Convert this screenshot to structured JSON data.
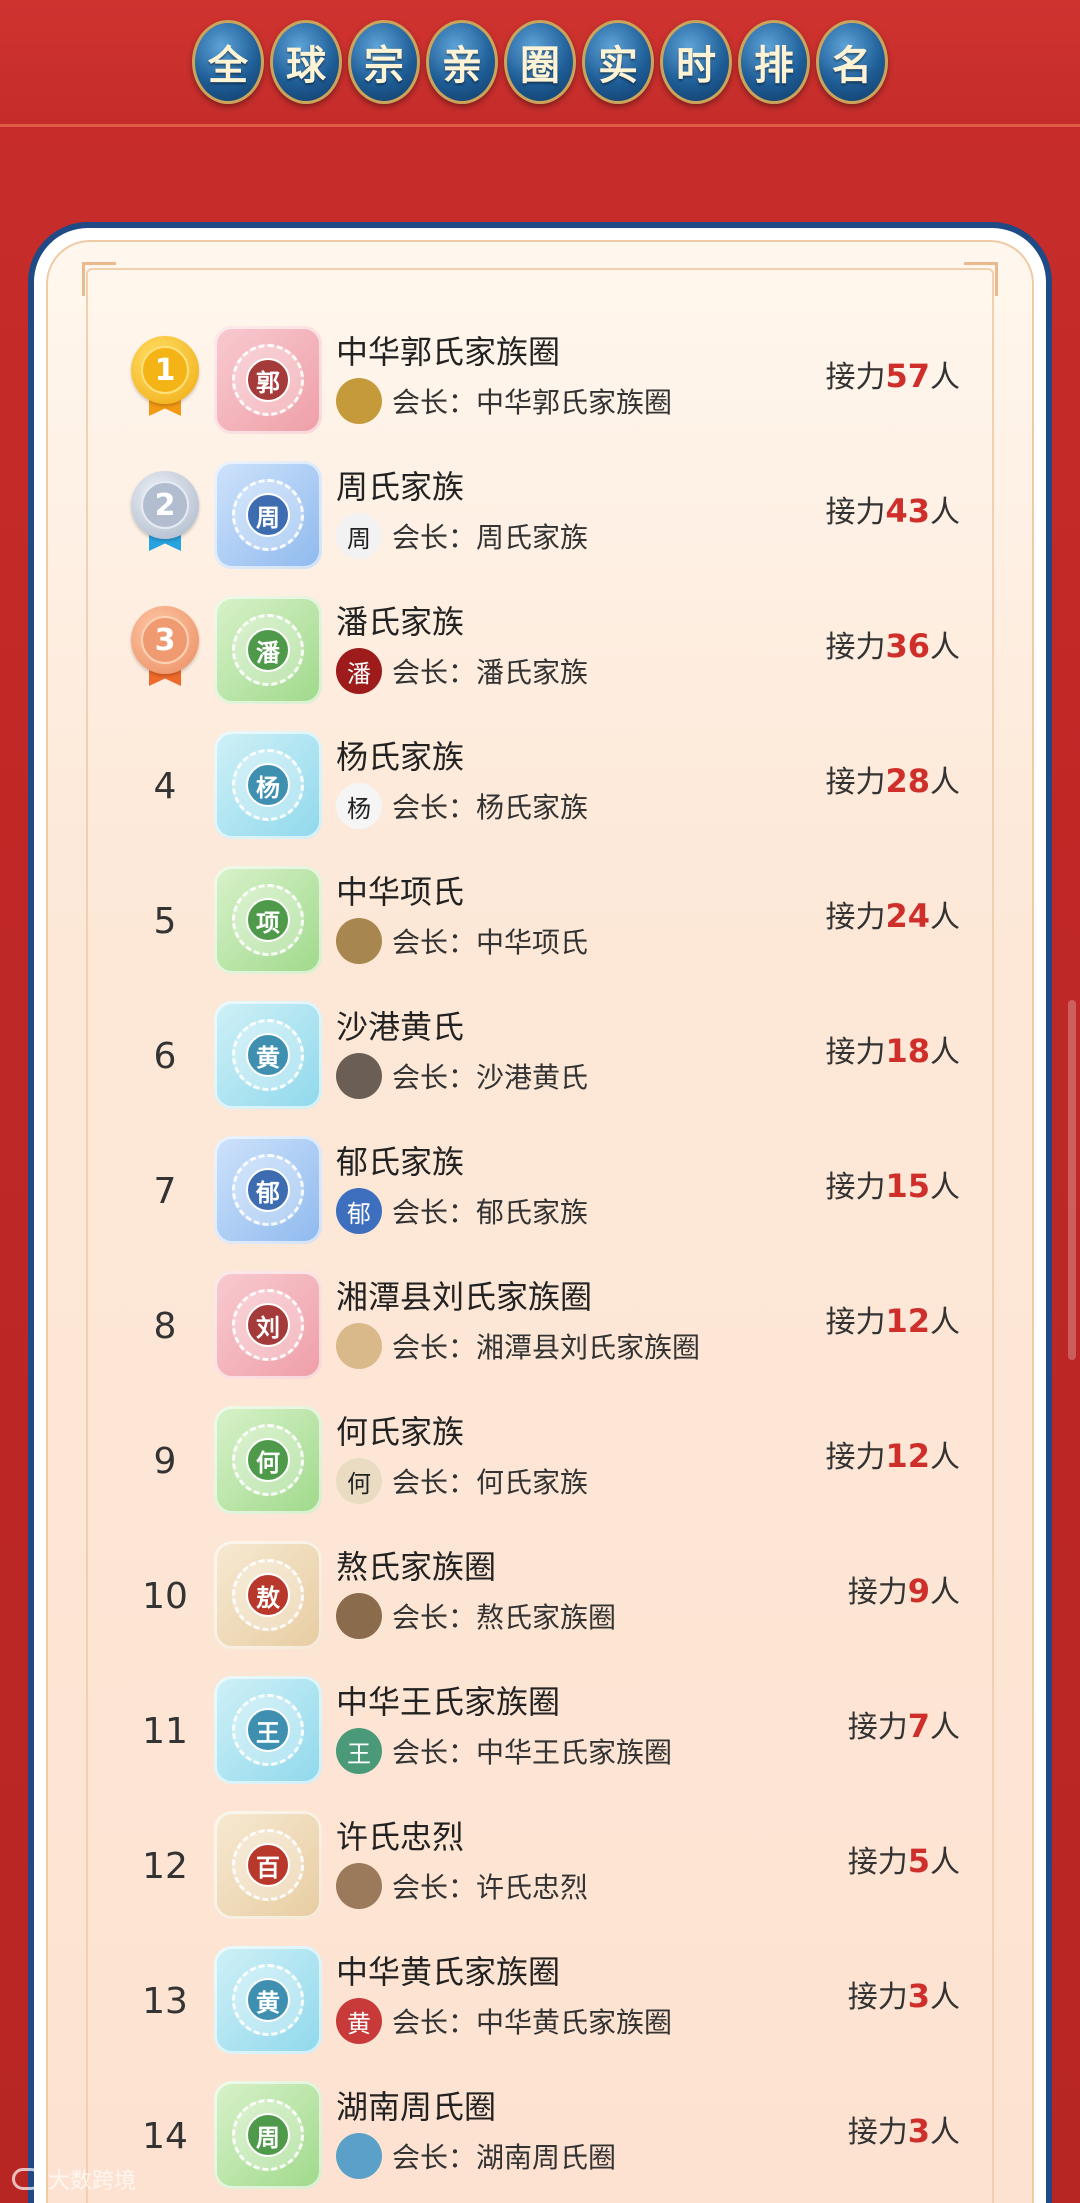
{
  "header": {
    "title_chars": [
      "全",
      "球",
      "宗",
      "亲",
      "圈",
      "实",
      "时",
      "排",
      "名"
    ]
  },
  "labels": {
    "relay_prefix": "接力",
    "relay_suffix": "人",
    "leader_prefix": "会长："
  },
  "rows": [
    {
      "rank": "1",
      "medal": "gold",
      "tile": "red",
      "surname": "郭",
      "name": "中华郭氏家族圈",
      "leader": "中华郭氏家族圈",
      "count": "57",
      "avatar_color": "#c49a3a",
      "avatar_text": ""
    },
    {
      "rank": "2",
      "medal": "silver",
      "tile": "blue",
      "surname": "周",
      "name": "周氏家族",
      "leader": "周氏家族",
      "count": "43",
      "avatar_color": "#f2f2f2",
      "avatar_text": "周"
    },
    {
      "rank": "3",
      "medal": "bronze",
      "tile": "green",
      "surname": "潘",
      "name": "潘氏家族",
      "leader": "潘氏家族",
      "count": "36",
      "avatar_color": "#9e1b1b",
      "avatar_text": "潘"
    },
    {
      "rank": "4",
      "medal": "",
      "tile": "cyan",
      "surname": "杨",
      "name": "杨氏家族",
      "leader": "杨氏家族",
      "count": "28",
      "avatar_color": "#f5f5f5",
      "avatar_text": "杨"
    },
    {
      "rank": "5",
      "medal": "",
      "tile": "green",
      "surname": "项",
      "name": "中华项氏",
      "leader": "中华项氏",
      "count": "24",
      "avatar_color": "#a8864f",
      "avatar_text": ""
    },
    {
      "rank": "6",
      "medal": "",
      "tile": "cyan",
      "surname": "黄",
      "name": "沙港黄氏",
      "leader": "沙港黄氏",
      "count": "18",
      "avatar_color": "#6b5e54",
      "avatar_text": ""
    },
    {
      "rank": "7",
      "medal": "",
      "tile": "blue",
      "surname": "郁",
      "name": "郁氏家族",
      "leader": "郁氏家族",
      "count": "15",
      "avatar_color": "#3e6fbf",
      "avatar_text": "郁"
    },
    {
      "rank": "8",
      "medal": "",
      "tile": "red",
      "surname": "刘",
      "name": "湘潭县刘氏家族圈",
      "leader": "湘潭县刘氏家族圈",
      "count": "12",
      "avatar_color": "#d9b98a",
      "avatar_text": ""
    },
    {
      "rank": "9",
      "medal": "",
      "tile": "green",
      "surname": "何",
      "name": "何氏家族",
      "leader": "何氏家族",
      "count": "12",
      "avatar_color": "#e9dcc3",
      "avatar_text": "何"
    },
    {
      "rank": "10",
      "medal": "",
      "tile": "tan",
      "surname": "敖",
      "name": "熬氏家族圈",
      "leader": "熬氏家族圈",
      "count": "9",
      "avatar_color": "#8a6b4c",
      "avatar_text": ""
    },
    {
      "rank": "11",
      "medal": "",
      "tile": "cyan",
      "surname": "王",
      "name": "中华王氏家族圈",
      "leader": "中华王氏家族圈",
      "count": "7",
      "avatar_color": "#4a9a7a",
      "avatar_text": "王"
    },
    {
      "rank": "12",
      "medal": "",
      "tile": "tan",
      "surname": "百",
      "name": "许氏忠烈",
      "leader": "许氏忠烈",
      "count": "5",
      "avatar_color": "#9a7a5a",
      "avatar_text": ""
    },
    {
      "rank": "13",
      "medal": "",
      "tile": "cyan",
      "surname": "黄",
      "name": "中华黄氏家族圈",
      "leader": "中华黄氏家族圈",
      "count": "3",
      "avatar_color": "#c83a3a",
      "avatar_text": "黄"
    },
    {
      "rank": "14",
      "medal": "",
      "tile": "green",
      "surname": "周",
      "name": "湖南周氏圈",
      "leader": "湖南周氏圈",
      "count": "3",
      "avatar_color": "#5aa0c8",
      "avatar_text": ""
    }
  ],
  "watermark": {
    "text": "大数跨境"
  }
}
